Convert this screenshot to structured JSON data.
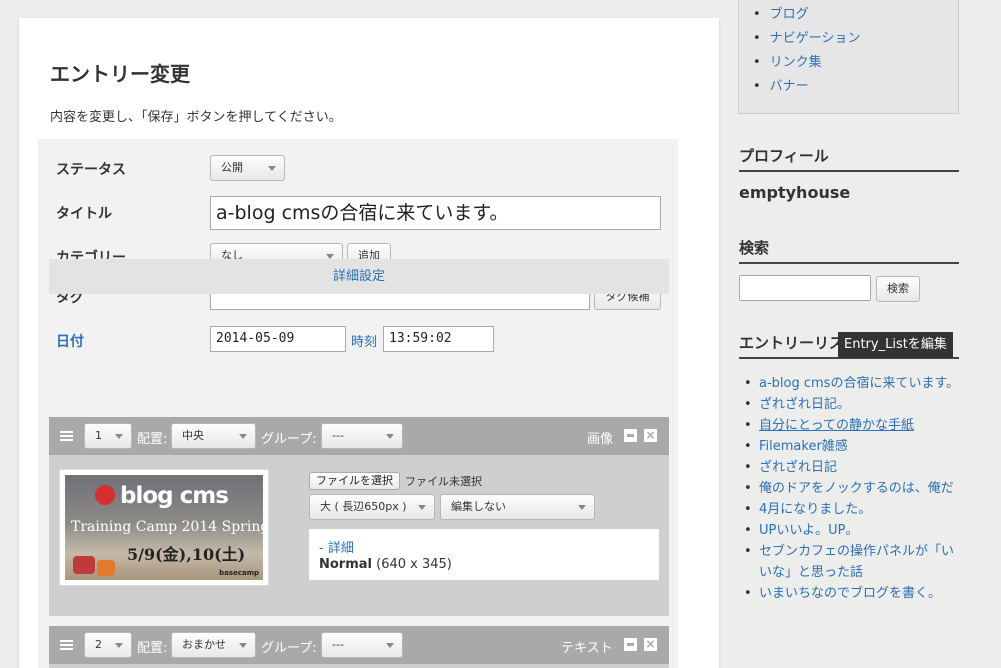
{
  "main": {
    "title": "エントリー変更",
    "description": "内容を変更し、「保存」ボタンを押してください。"
  },
  "form": {
    "status_label": "ステータス",
    "status_value": "公開",
    "title_label": "タイトル",
    "title_value": "a-blog cmsの合宿に来ています。",
    "category_label": "カテゴリー",
    "category_value": "なし",
    "category_add": "追加",
    "tag_label": "タグ",
    "tag_value": "",
    "tag_suggest": "タグ候補",
    "date_label": "日付",
    "date_value": "2014-05-09",
    "time_label": "時刻",
    "time_value": "13:59:02",
    "advanced_label": "詳細設定"
  },
  "units": [
    {
      "order": "1",
      "align_label": "配置:",
      "align_value": "中央",
      "group_label": "グループ:",
      "group_value": "---",
      "type": "画像",
      "file_button": "ファイルを選択",
      "file_status": "ファイル未選択",
      "size_value": "大 ( 長辺650px )",
      "edit_value": "編集しない",
      "detail_link": "- 詳細",
      "detail_size_name": "Normal",
      "detail_size_dims": "(640 x 345)",
      "image": {
        "logo_text": "blog cms",
        "camp_text": "Training Camp 2014 Spring",
        "date_text": "5/9(金),10(土)",
        "sponsor_text": "basecamp"
      }
    },
    {
      "order": "2",
      "align_label": "配置:",
      "align_value": "おまかせ",
      "group_label": "グループ:",
      "group_value": "---",
      "type": "テキスト"
    }
  ],
  "sidebar": {
    "menu": [
      "ブログ",
      "ナビゲーション",
      "リンク集",
      "バナー"
    ],
    "profile_heading": "プロフィール",
    "profile_name": "emptyhouse",
    "search_heading": "検索",
    "search_button": "検索",
    "entries_heading": "エントリーリスト",
    "tooltip": "Entry_Listを編集",
    "entries": [
      "a-blog cmsの合宿に来ています。",
      "ざれざれ日記。",
      "自分にとっての静かな手紙",
      "Filemaker雑感",
      "ざれざれ日記",
      "俺のドアをノックするのは、俺だ",
      "4月になりました。",
      "UPいいよ。UP。",
      "セブンカフェの操作パネルが「いいな」と思った話",
      "いまいちなのでブログを書く。"
    ]
  }
}
